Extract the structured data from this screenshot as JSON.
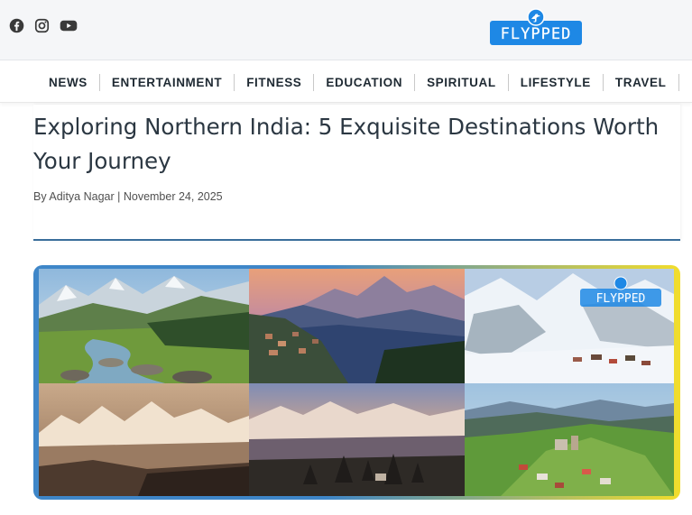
{
  "header": {
    "social": [
      {
        "name": "facebook",
        "icon": "facebook-icon"
      },
      {
        "name": "instagram",
        "icon": "instagram-icon"
      },
      {
        "name": "youtube",
        "icon": "youtube-icon"
      }
    ],
    "logo_text": "FLYPPED",
    "logo_color": "#1e88e5"
  },
  "nav": {
    "items": [
      "NEWS",
      "ENTERTAINMENT",
      "FITNESS",
      "EDUCATION",
      "SPIRITUAL",
      "LIFESTYLE",
      "TRAVEL"
    ]
  },
  "article": {
    "title": "Exploring Northern India: 5 Exquisite Destinations Worth Your Journey",
    "byline_prefix": "By ",
    "author": "Aditya Nagar",
    "separator": " | ",
    "date": "November 24, 2025",
    "accent_color": "#3a6e9b"
  },
  "hero": {
    "watermark": "FLYPPED",
    "frame_colors": [
      "#3e86c8",
      "#f2dd2c"
    ]
  }
}
